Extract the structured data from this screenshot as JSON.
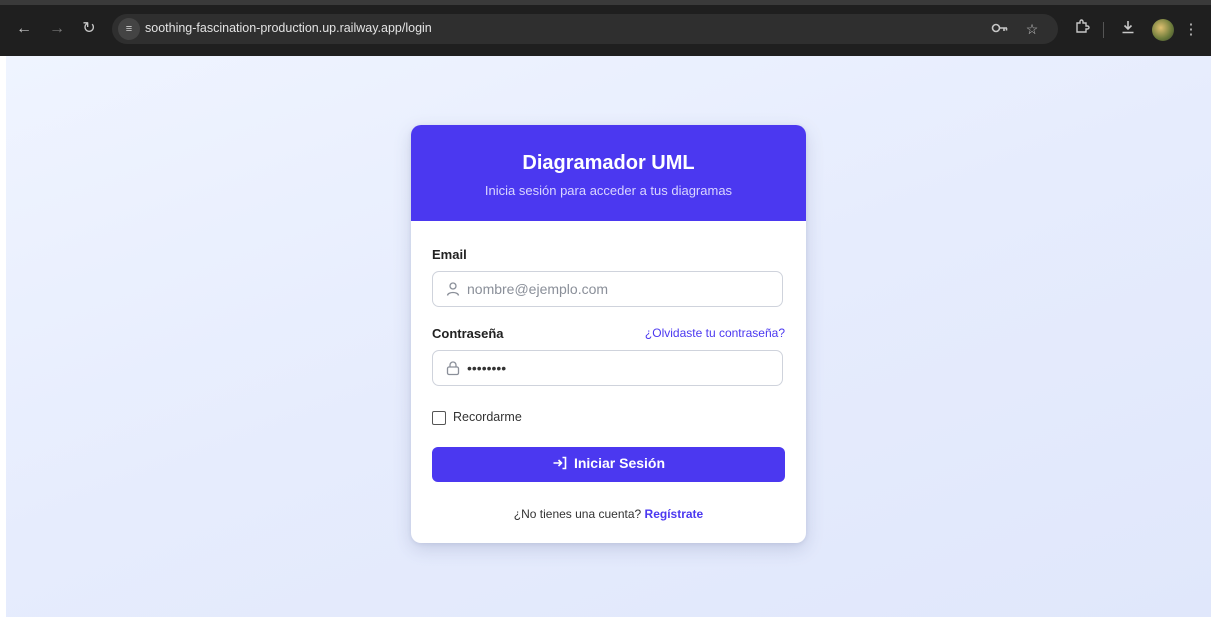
{
  "browser": {
    "url": "soothing-fascination-production.up.railway.app/login",
    "icons": {
      "back": "arrow-left-icon",
      "forward": "arrow-right-icon",
      "reload": "reload-icon",
      "site_info": "tune-icon",
      "password": "key-icon",
      "bookmark": "star-icon",
      "extensions": "puzzle-icon",
      "downloads": "download-icon",
      "profile": "avatar",
      "menu": "kebab-menu-icon"
    }
  },
  "login": {
    "title": "Diagramador UML",
    "subtitle": "Inicia sesión para acceder a tus diagramas",
    "email_label": "Email",
    "email_placeholder": "nombre@ejemplo.com",
    "password_label": "Contraseña",
    "password_value": "12345678",
    "forgot_link": "¿Olvidaste tu contraseña?",
    "remember_label": "Recordarme",
    "remember_checked": false,
    "submit_label": "Iniciar Sesión",
    "signup_prompt": "¿No tienes una cuenta?",
    "signup_link": "Regístrate"
  },
  "colors": {
    "accent": "#4b38f0",
    "page_bg": "#e6ecfd",
    "chrome_bg": "#1f1f1f"
  }
}
